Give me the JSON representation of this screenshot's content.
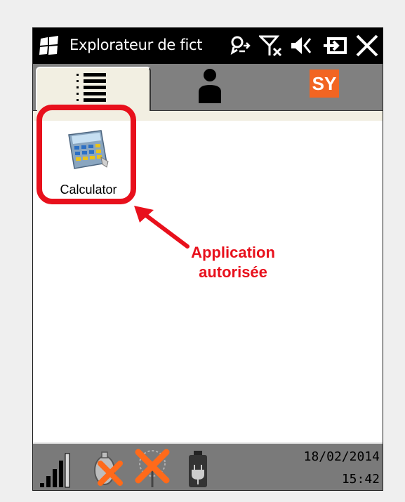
{
  "window": {
    "title": "Explorateur de fict"
  },
  "icons": {
    "start": "windows-flag-icon",
    "sync": "sync-icon",
    "signal": "no-signal-icon",
    "volume": "volume-icon",
    "ok": "ok-icon",
    "close": "close-icon"
  },
  "tabs": [
    {
      "name": "list-view",
      "icon": "list-icon",
      "selected": true
    },
    {
      "name": "contacts",
      "icon": "person-icon"
    },
    {
      "name": "sy",
      "label": "SY"
    }
  ],
  "content": {
    "items": [
      {
        "label": "Calculator",
        "icon": "calculator-icon"
      }
    ]
  },
  "status": {
    "date": "18/02/2014",
    "time": "15:42",
    "icons": [
      "signal-bars-icon",
      "gps-disabled-icon",
      "wireless-disabled-icon",
      "battery-plug-icon"
    ]
  },
  "annotation": {
    "line1": "Application",
    "line2": "autorisée",
    "color": "#e8101c"
  },
  "colors": {
    "accent_sy": "#f26522",
    "tab_selected": "#f2efe2"
  }
}
